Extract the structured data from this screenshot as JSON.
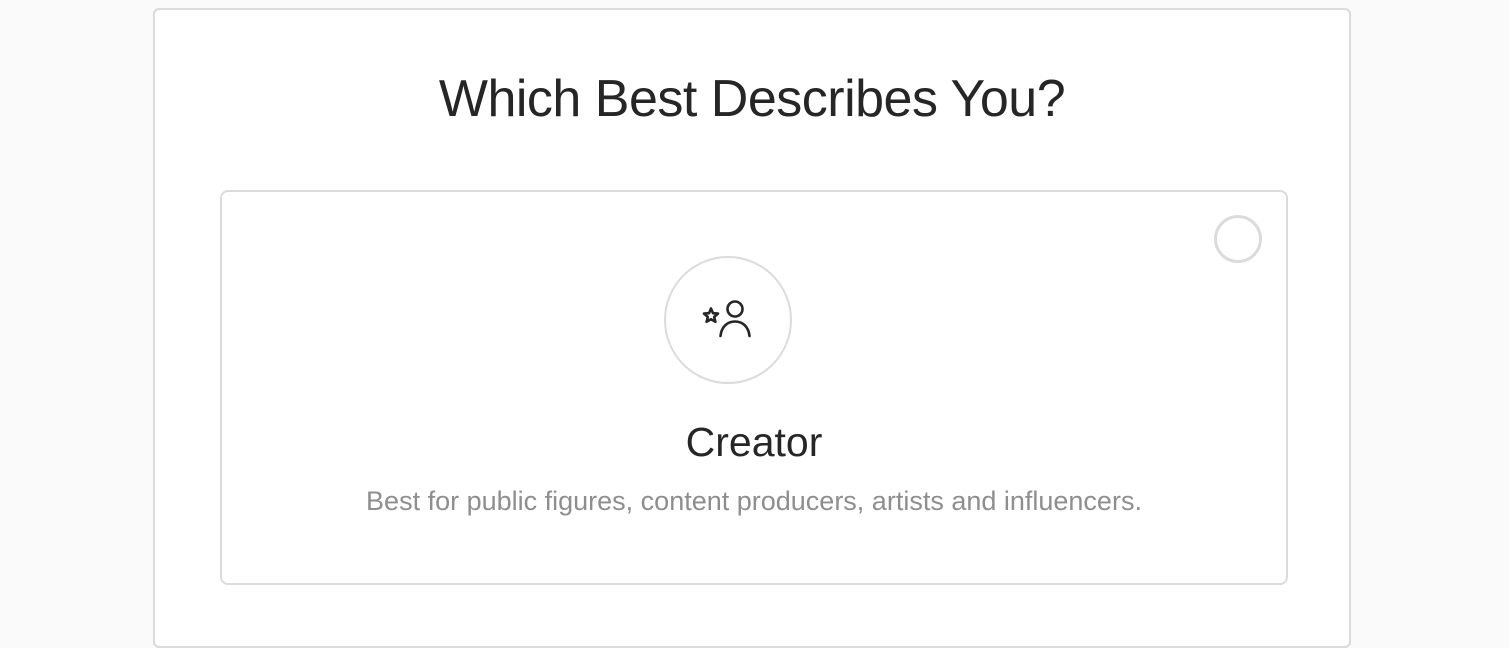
{
  "page": {
    "title": "Which Best Describes You?"
  },
  "options": [
    {
      "icon": "creator-icon",
      "label": "Creator",
      "description": "Best for public figures, content producers, artists and influencers.",
      "selected": false
    }
  ],
  "colors": {
    "background": "#fafafa",
    "panel": "#ffffff",
    "border": "#dbdbdb",
    "text_primary": "#262626",
    "text_secondary": "#8e8e8e"
  }
}
